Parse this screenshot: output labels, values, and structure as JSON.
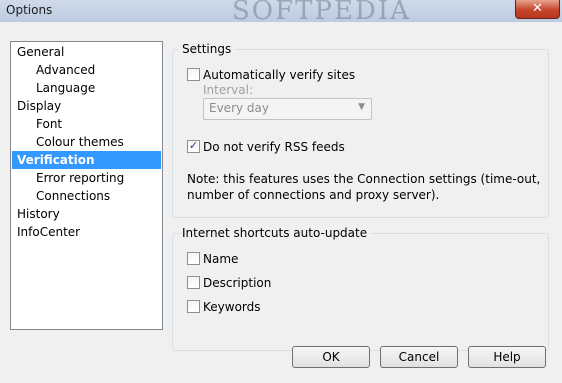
{
  "window": {
    "title": "Options",
    "watermark": "SOFTPEDIA",
    "close_glyph": "✕"
  },
  "tree": {
    "items": [
      {
        "label": "General"
      },
      {
        "label": "Advanced"
      },
      {
        "label": "Language"
      },
      {
        "label": "Display"
      },
      {
        "label": "Font"
      },
      {
        "label": "Colour themes"
      },
      {
        "label": "Verification"
      },
      {
        "label": "Error reporting"
      },
      {
        "label": "Connections"
      },
      {
        "label": "History"
      },
      {
        "label": "InfoCenter"
      }
    ],
    "selected": "Verification"
  },
  "settings": {
    "title": "Settings",
    "auto_verify": {
      "label": "Automatically verify sites",
      "checked": false
    },
    "interval_label": "Interval:",
    "interval_value": "Every day",
    "no_rss": {
      "label": "Do not verify RSS feeds",
      "checked": true
    },
    "note_line1": "Note: this features uses the Connection settings (time-out,",
    "note_line2": "number of connections and proxy server)."
  },
  "shortcuts": {
    "title": "Internet shortcuts auto-update",
    "name": {
      "label": "Name",
      "checked": false
    },
    "description": {
      "label": "Description",
      "checked": false
    },
    "keywords": {
      "label": "Keywords",
      "checked": false
    }
  },
  "buttons": {
    "ok": "OK",
    "cancel": "Cancel",
    "help": "Help"
  },
  "colors": {
    "selection": "#3399ff",
    "accent": "#1c3d85"
  }
}
